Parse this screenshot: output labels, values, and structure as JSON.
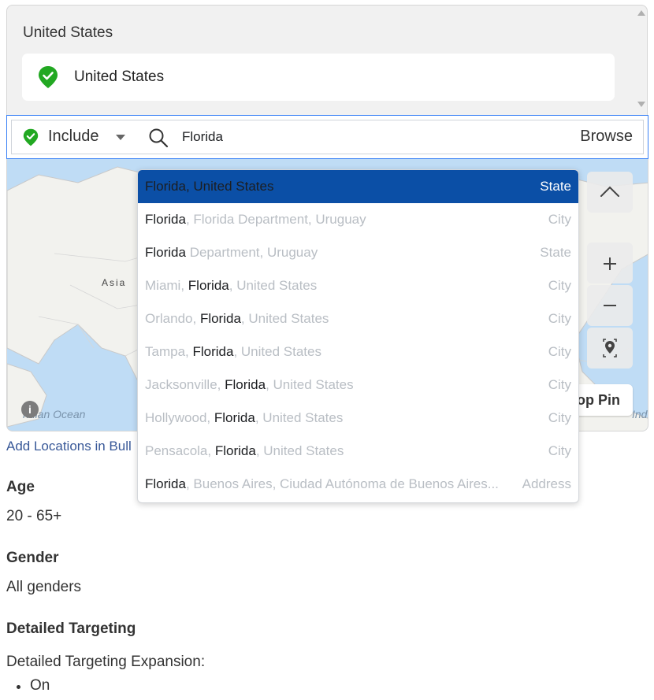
{
  "selected_locations": {
    "group_title": "United States",
    "items": [
      {
        "label": "United States"
      }
    ]
  },
  "search": {
    "mode_label": "Include",
    "value": "Florida",
    "browse_label": "Browse"
  },
  "map": {
    "label_asia": "Asia",
    "label_ocean": "ndian Ocean",
    "label_ocean_right": "Indi",
    "drop_pin_label": "op Pin",
    "info_glyph": "i"
  },
  "suggestions": [
    {
      "parts": [
        [
          "strong",
          "Florida, United States"
        ]
      ],
      "type": "State",
      "selected": true
    },
    {
      "parts": [
        [
          "strong",
          "Florida"
        ],
        [
          "dim",
          ", Florida Department, Uruguay"
        ]
      ],
      "type": "City"
    },
    {
      "parts": [
        [
          "strong",
          "Florida"
        ],
        [
          "dim",
          " Department, Uruguay"
        ]
      ],
      "type": "State"
    },
    {
      "parts": [
        [
          "dim",
          "Miami, "
        ],
        [
          "strong",
          "Florida"
        ],
        [
          "dim",
          ", United States"
        ]
      ],
      "type": "City"
    },
    {
      "parts": [
        [
          "dim",
          "Orlando, "
        ],
        [
          "strong",
          "Florida"
        ],
        [
          "dim",
          ", United States"
        ]
      ],
      "type": "City"
    },
    {
      "parts": [
        [
          "dim",
          "Tampa, "
        ],
        [
          "strong",
          "Florida"
        ],
        [
          "dim",
          ", United States"
        ]
      ],
      "type": "City"
    },
    {
      "parts": [
        [
          "dim",
          "Jacksonville, "
        ],
        [
          "strong",
          "Florida"
        ],
        [
          "dim",
          ", United States"
        ]
      ],
      "type": "City"
    },
    {
      "parts": [
        [
          "dim",
          "Hollywood, "
        ],
        [
          "strong",
          "Florida"
        ],
        [
          "dim",
          ", United States"
        ]
      ],
      "type": "City"
    },
    {
      "parts": [
        [
          "dim",
          "Pensacola, "
        ],
        [
          "strong",
          "Florida"
        ],
        [
          "dim",
          ", United States"
        ]
      ],
      "type": "City"
    },
    {
      "parts": [
        [
          "strong",
          "Florida"
        ],
        [
          "dim",
          ", Buenos Aires, Ciudad Autónoma de Buenos Aires..."
        ]
      ],
      "type": "Address"
    }
  ],
  "bulk_link": "Add Locations in Bull",
  "age": {
    "title": "Age",
    "value": "20 - 65+"
  },
  "gender": {
    "title": "Gender",
    "value": "All genders"
  },
  "detailed_targeting": {
    "title": "Detailed Targeting",
    "expansion_label": "Detailed Targeting Expansion:",
    "expansion_items": [
      "On"
    ]
  },
  "colors": {
    "accent_blue": "#0b4fa6",
    "include_green": "#22a822",
    "link_blue": "#385898",
    "map_water": "#bfdcf5"
  }
}
